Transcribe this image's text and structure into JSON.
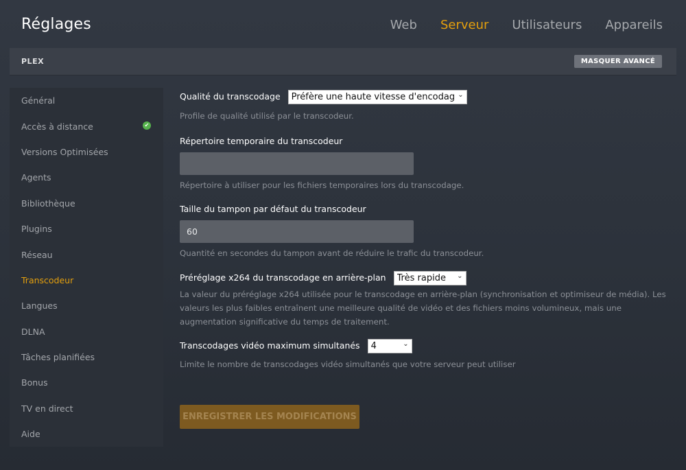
{
  "header": {
    "title": "Réglages",
    "tabs": [
      {
        "label": "Web",
        "active": false
      },
      {
        "label": "Serveur",
        "active": true
      },
      {
        "label": "Utilisateurs",
        "active": false
      },
      {
        "label": "Appareils",
        "active": false
      }
    ]
  },
  "section": {
    "label": "PLEX",
    "advanced_button": "MASQUER AVANCÉ"
  },
  "sidebar": {
    "items": [
      {
        "label": "Général"
      },
      {
        "label": "Accès à distance",
        "status_icon": "check-circle-icon"
      },
      {
        "label": "Versions Optimisées"
      },
      {
        "label": "Agents"
      },
      {
        "label": "Bibliothèque"
      },
      {
        "label": "Plugins"
      },
      {
        "label": "Réseau"
      },
      {
        "label": "Transcodeur",
        "active": true
      },
      {
        "label": "Langues"
      },
      {
        "label": "DLNA"
      },
      {
        "label": "Tâches planifiées"
      },
      {
        "label": "Bonus"
      },
      {
        "label": "TV en direct"
      },
      {
        "label": "Aide"
      }
    ]
  },
  "form": {
    "quality": {
      "label": "Qualité du transcodage",
      "value": "Préfère une haute vitesse d'encodage",
      "help": "Profile de qualité utilisé par le transcodeur."
    },
    "temp_dir": {
      "label": "Répertoire temporaire du transcodeur",
      "value": "",
      "help": "Répertoire à utiliser pour les fichiers temporaires lors du transcodage."
    },
    "buffer": {
      "label": "Taille du tampon par défaut du transcodeur",
      "value": "60",
      "help": "Quantité en secondes du tampon avant de réduire le trafic du transcodeur."
    },
    "preset": {
      "label": "Préréglage x264 du transcodage en arrière-plan",
      "value": "Très rapide",
      "help": "La valeur du préréglage x264 utilisée pour le transcodage en arrière-plan (synchronisation et optimiseur de média). Les valeurs les plus faibles entraînent une meilleure qualité de vidéo et des fichiers moins volumineux, mais une augmentation significative du temps de traitement."
    },
    "max_transcodes": {
      "label": "Transcodages vidéo maximum simultanés",
      "value": "4",
      "help": "Limite le nombre de transcodages vidéo simultanés que votre serveur peut utiliser"
    },
    "save_label": "ENREGISTRER LES MODIFICATIONS"
  },
  "colors": {
    "accent": "#e5a00d",
    "success": "#57b34d",
    "save_disabled": "#7d5a20"
  }
}
